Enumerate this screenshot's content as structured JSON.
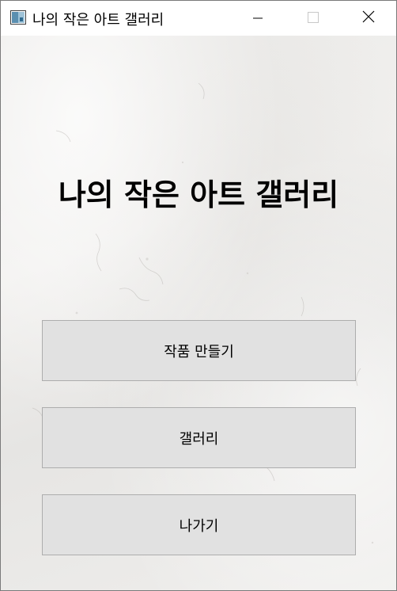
{
  "window": {
    "title": "나의 작은 아트 갤러리",
    "icon": "app-window-icon",
    "controls": [
      "minimize-icon",
      "maximize-icon",
      "close-icon"
    ]
  },
  "main": {
    "headline": "나의 작은 아트 갤러리",
    "buttons": [
      {
        "label": "작품 만들기"
      },
      {
        "label": "갤러리"
      },
      {
        "label": "나가기"
      }
    ]
  },
  "colors": {
    "background": "#ecebe9",
    "button_face": "#e1e1e1",
    "button_border": "#adadad",
    "text": "#000000"
  }
}
